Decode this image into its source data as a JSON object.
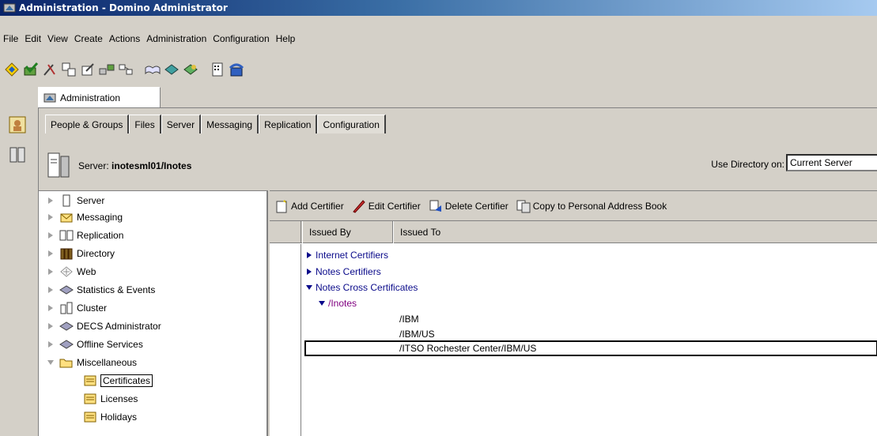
{
  "window": {
    "title": "Administration - Domino Administrator"
  },
  "menu": [
    "File",
    "Edit",
    "View",
    "Create",
    "Actions",
    "Administration",
    "Configuration",
    "Help"
  ],
  "document_tab": {
    "label": "Administration"
  },
  "tabs": [
    "People & Groups",
    "Files",
    "Server",
    "Messaging",
    "Replication",
    "Configuration"
  ],
  "server": {
    "prefix": "Server:",
    "name": "inotesml01/Inotes"
  },
  "directory": {
    "label": "Use Directory on:",
    "value": "Current Server"
  },
  "nav": {
    "items": [
      "Server",
      "Messaging",
      "Replication",
      "Directory",
      "Web",
      "Statistics & Events",
      "Cluster",
      "DECS Administrator",
      "Offline Services",
      "Miscellaneous"
    ],
    "sub_items": [
      "Certificates",
      "Licenses",
      "Holidays"
    ]
  },
  "actions": [
    "Add Certifier",
    "Edit Certifier",
    "Delete Certifier",
    "Copy to Personal Address Book"
  ],
  "columns": [
    "Issued By",
    "Issued To"
  ],
  "view": {
    "categories": [
      "Internet Certifiers",
      "Notes Certifiers",
      "Notes Cross Certificates"
    ],
    "subcategory": "/Inotes",
    "entries": [
      "/IBM",
      "/IBM/US",
      "/ITSO Rochester Center/IBM/US"
    ]
  },
  "colors": {
    "title_start": "#0a246a",
    "title_end": "#a6caf0",
    "category_text": "#0a0a8a",
    "subcategory_text": "#800080",
    "chrome": "#d4d0c8"
  }
}
